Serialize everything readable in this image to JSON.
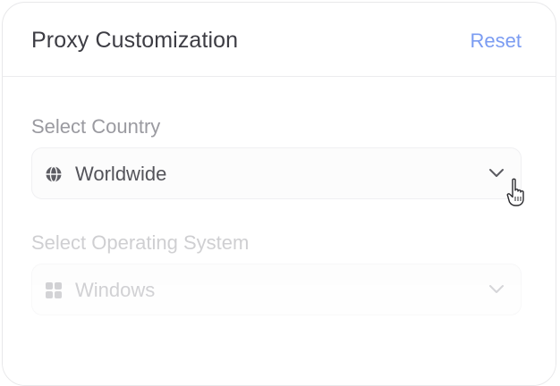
{
  "header": {
    "title": "Proxy Customization",
    "reset_label": "Reset"
  },
  "country": {
    "label": "Select Country",
    "value": "Worldwide",
    "icon": "globe-icon"
  },
  "os": {
    "label": "Select Operating System",
    "value": "Windows",
    "icon": "windows-icon"
  },
  "colors": {
    "accent": "#7b9cf2",
    "title": "#3d3d44",
    "muted": "#9a9aa0"
  }
}
